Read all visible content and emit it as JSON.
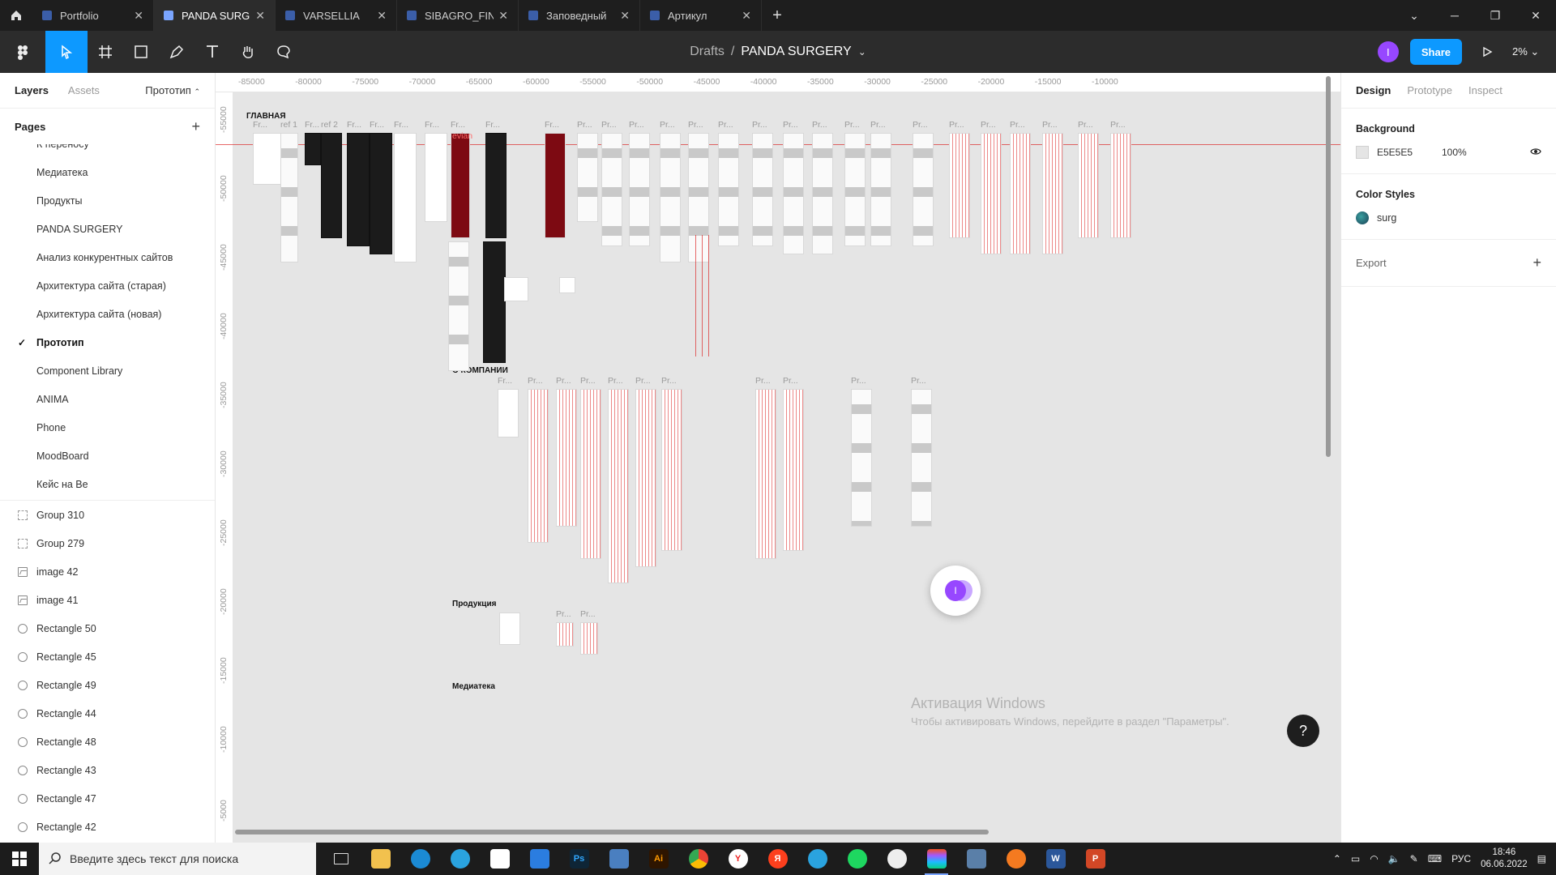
{
  "tabs": [
    {
      "label": "Portfolio",
      "active": false
    },
    {
      "label": "PANDA SURGERY",
      "active": true
    },
    {
      "label": "VARSELLIA",
      "active": false
    },
    {
      "label": "SIBAGRO_FINAL",
      "active": false
    },
    {
      "label": "Заповедный",
      "active": false
    },
    {
      "label": "Артикул",
      "active": false
    }
  ],
  "toolbar": {
    "breadcrumb": "Drafts",
    "separator": "/",
    "file_name": "PANDA SURGERY",
    "avatar_initial": "I",
    "share_label": "Share",
    "zoom": "2%"
  },
  "left": {
    "tab_layers": "Layers",
    "tab_assets": "Assets",
    "current_page_select": "Прототип",
    "pages_title": "Pages",
    "pages": [
      "К переносу",
      "Медиатека",
      "Продукты",
      "PANDA SURGERY",
      "Анализ конкурентных сайтов",
      "Архитектура сайта (старая)",
      "Архитектура сайта (новая)",
      "Прототип",
      "Component Library",
      "ANIMA",
      "Phone",
      "MoodBoard",
      "Кейс на Be"
    ],
    "current_page": "Прототип",
    "layers": [
      {
        "label": "Group 310",
        "icon": "group-icon"
      },
      {
        "label": "Group 279",
        "icon": "group-icon"
      },
      {
        "label": "image 42",
        "icon": "image-icon"
      },
      {
        "label": "image 41",
        "icon": "image-icon"
      },
      {
        "label": "Rectangle 50",
        "icon": "ellipse-icon"
      },
      {
        "label": "Rectangle 45",
        "icon": "ellipse-icon"
      },
      {
        "label": "Rectangle 49",
        "icon": "ellipse-icon"
      },
      {
        "label": "Rectangle 44",
        "icon": "ellipse-icon"
      },
      {
        "label": "Rectangle 48",
        "icon": "ellipse-icon"
      },
      {
        "label": "Rectangle 43",
        "icon": "ellipse-icon"
      },
      {
        "label": "Rectangle 47",
        "icon": "ellipse-icon"
      },
      {
        "label": "Rectangle 42",
        "icon": "ellipse-icon"
      }
    ]
  },
  "right": {
    "tab_design": "Design",
    "tab_prototype": "Prototype",
    "tab_inspect": "Inspect",
    "background_title": "Background",
    "background_hex": "E5E5E5",
    "background_opacity": "100%",
    "background_color": "#e5e5e5",
    "color_styles_title": "Color Styles",
    "color_style_name": "surg",
    "export_title": "Export"
  },
  "canvas": {
    "ruler_x": [
      "-85000",
      "-80000",
      "-75000",
      "-70000",
      "-65000",
      "-60000",
      "-55000",
      "-50000",
      "-45000",
      "-40000",
      "-35000",
      "-30000",
      "-25000",
      "-20000",
      "-15000",
      "-10000"
    ],
    "ruler_y": [
      "-55000",
      "-50000",
      "-45000",
      "-40000",
      "-35000",
      "-30000",
      "-25000",
      "-20000",
      "-15000",
      "-10000",
      "-5000"
    ],
    "section_main": "ГЛАВНАЯ",
    "section_company": "О КОМПАНИИ",
    "section_products": "Продукция",
    "section_media": "Медиатека",
    "frame_label_ref1": "ref 1",
    "frame_label_ref2": "ref 2",
    "frame_label_fr": "Fr...",
    "frame_label_pr": "Pr...",
    "frame_evian": "evian",
    "cursor_initial": "I"
  },
  "watermark": {
    "line1": "Активация Windows",
    "line2": "Чтобы активировать Windows, перейдите в раздел \"Параметры\"."
  },
  "help_label": "?",
  "taskbar": {
    "search_placeholder": "Введите здесь текст для поиска",
    "lang": "РУС",
    "time": "18:46",
    "date": "06.06.2022"
  },
  "colors": {
    "accent": "#0d99ff",
    "avatar": "#9747ff",
    "guide_red": "#dc2828"
  }
}
